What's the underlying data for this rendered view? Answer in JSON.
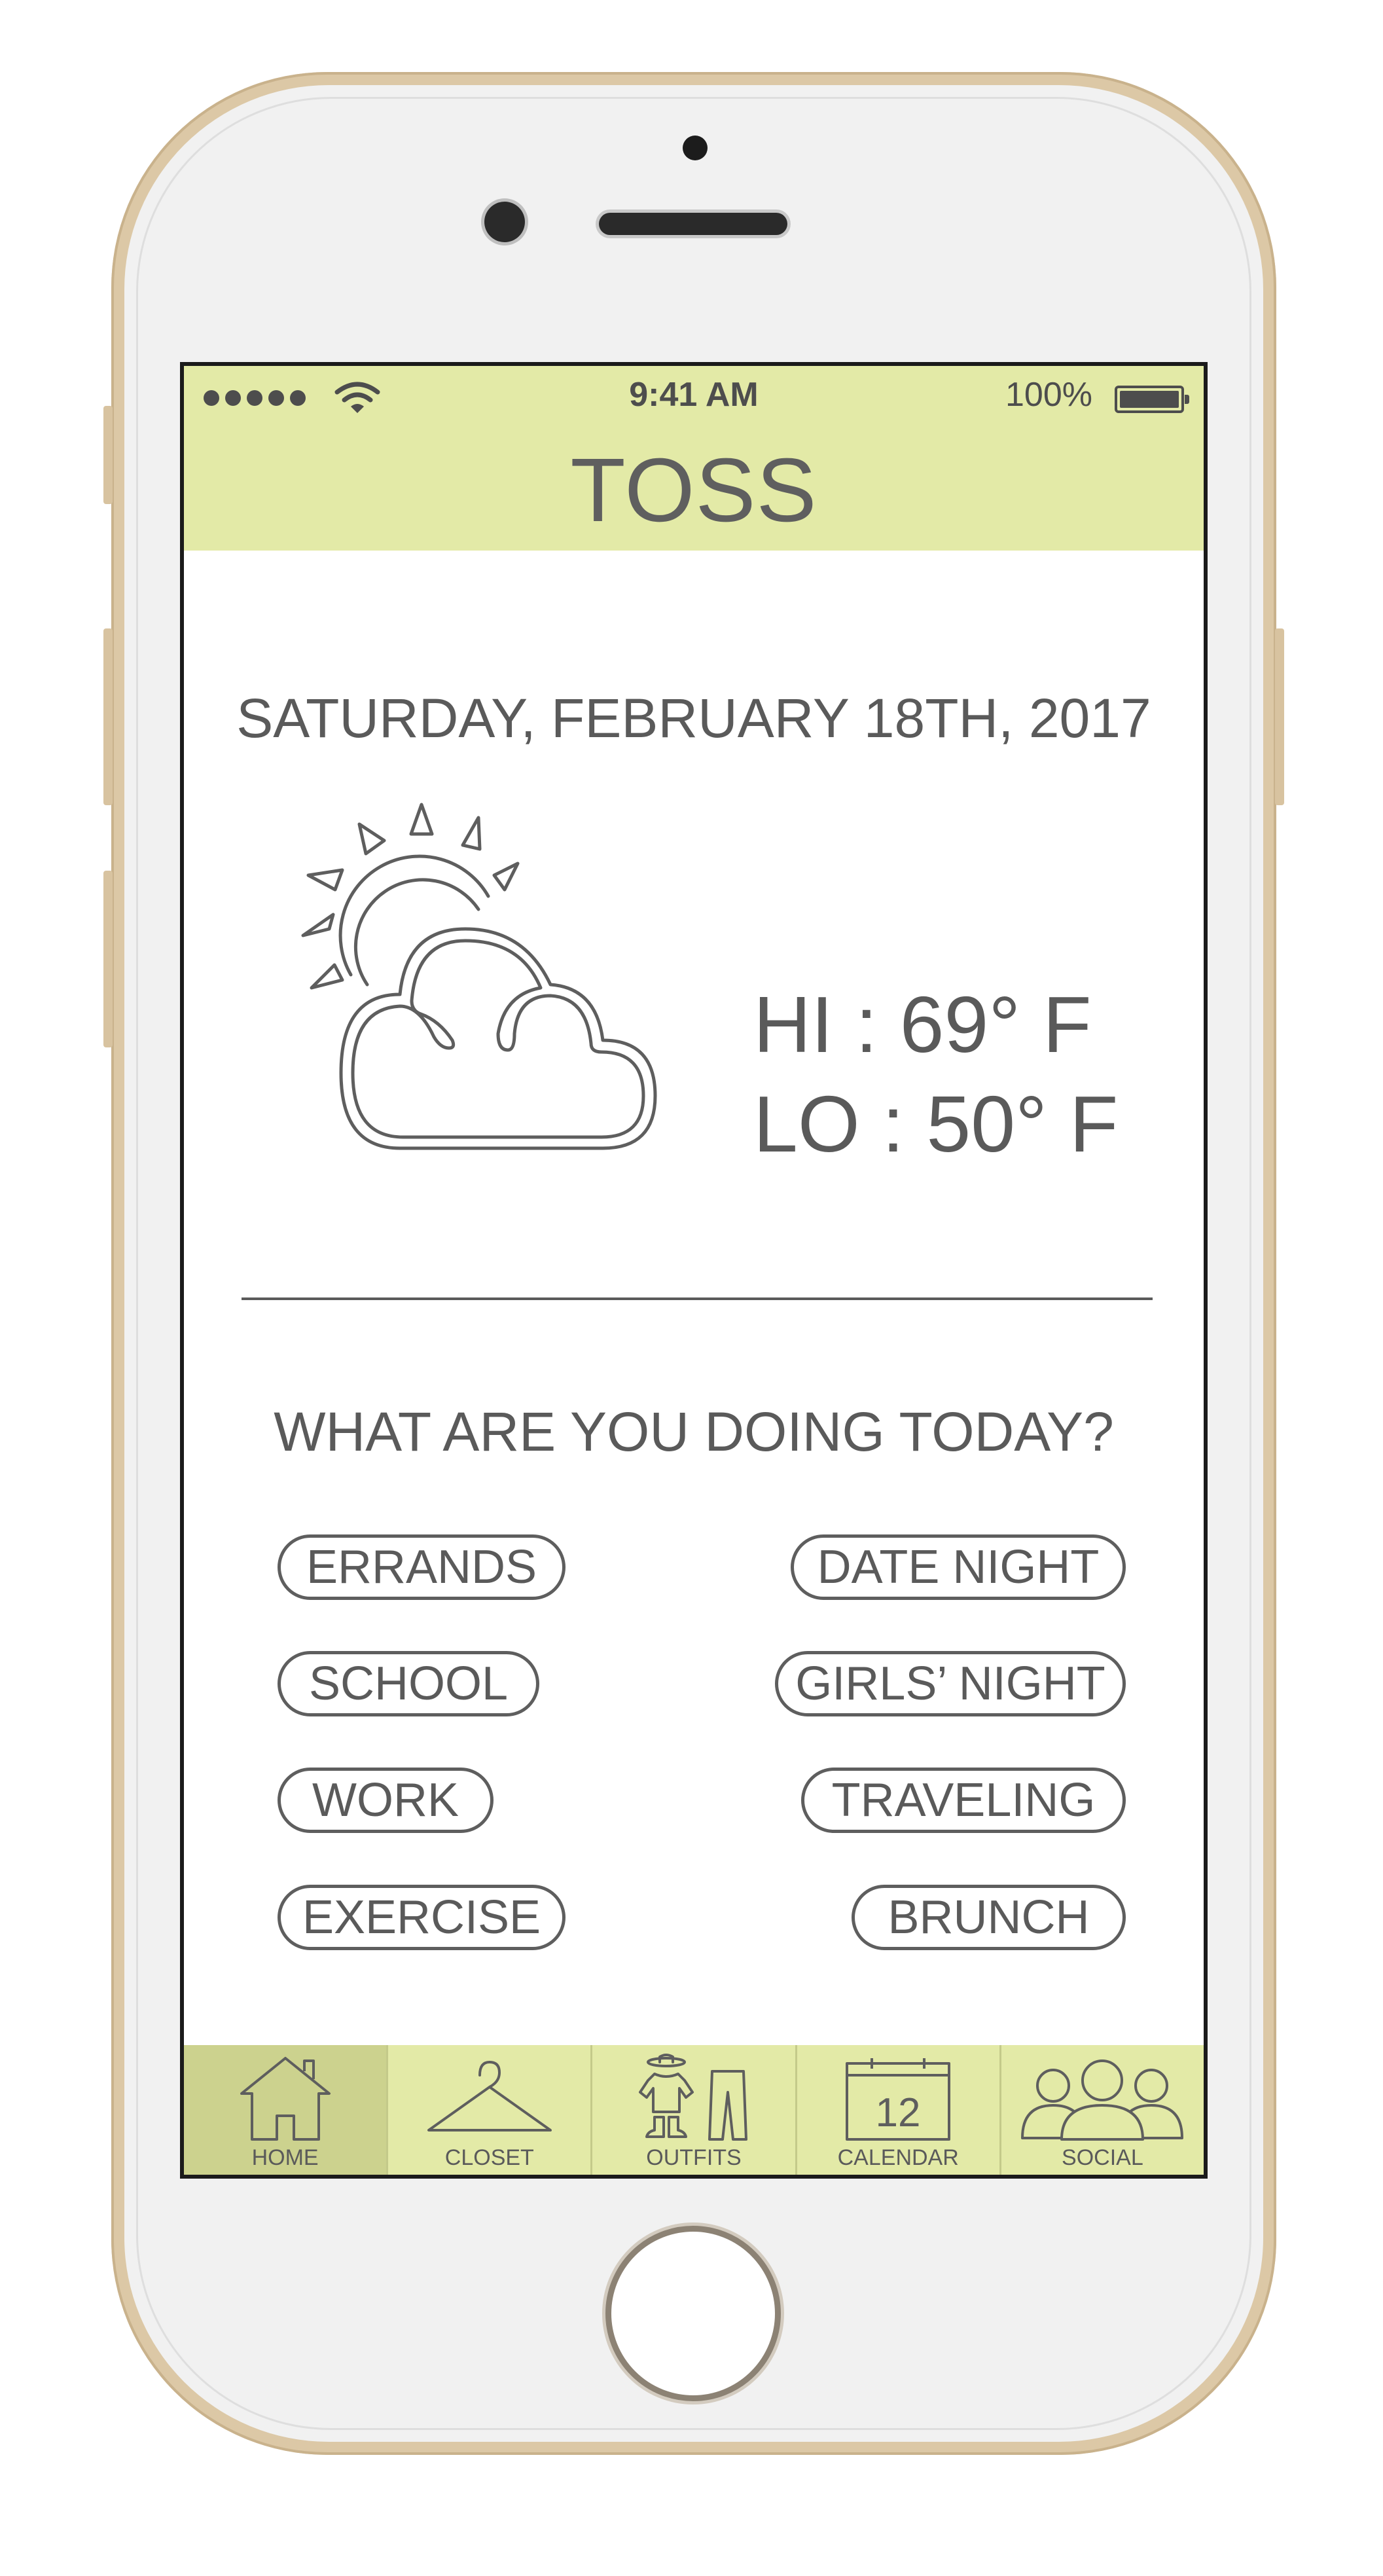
{
  "status_bar": {
    "time": "9:41 AM",
    "battery": "100%",
    "signal_icon": "signal-dots-icon",
    "wifi_icon": "wifi-icon",
    "battery_icon": "battery-icon"
  },
  "header": {
    "title": "TOSS"
  },
  "today": {
    "date": "SATURDAY, FEBRUARY 18TH, 2017",
    "weather_icon": "partly-cloudy-icon",
    "hi": "HI : 69° F",
    "lo": "LO : 50° F"
  },
  "activities": {
    "question": "WHAT ARE YOU DOING TODAY?",
    "left": [
      "ERRANDS",
      "SCHOOL",
      "WORK",
      "EXERCISE"
    ],
    "right": [
      "DATE NIGHT",
      "GIRLS’ NIGHT",
      "TRAVELING",
      "BRUNCH"
    ]
  },
  "tabs": [
    {
      "label": "HOME",
      "icon": "house-icon",
      "active": true
    },
    {
      "label": "CLOSET",
      "icon": "hanger-icon",
      "active": false
    },
    {
      "label": "OUTFITS",
      "icon": "clothes-icon",
      "active": false
    },
    {
      "label": "CALENDAR",
      "icon": "calendar-icon",
      "active": false,
      "calendar_day": "12"
    },
    {
      "label": "SOCIAL",
      "icon": "people-icon",
      "active": false
    }
  ],
  "colors": {
    "accent": "#e3eaa7",
    "active_tab": "#ccd28e",
    "text": "#5a5a5a",
    "phone_gold": "#dcc8a6"
  }
}
